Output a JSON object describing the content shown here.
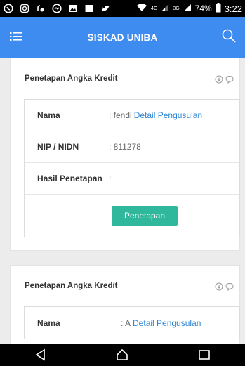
{
  "status_bar": {
    "network_labels": [
      "4G",
      "3G"
    ],
    "battery": "74%",
    "time": "3:22",
    "icons": [
      "whatsapp-icon",
      "instagram-icon",
      "wifi-calling-icon",
      "chat-bubble-icon",
      "gallery-icon",
      "box-icon",
      "twitter-icon",
      "wifi-icon",
      "signal-icon",
      "signal-icon",
      "battery-icon"
    ]
  },
  "header": {
    "title": "SISKAD UNIBA",
    "background_color": "#3f8cf0"
  },
  "cards": [
    {
      "title": "Penetapan Angka Kredit",
      "rows": [
        {
          "label": "Nama",
          "value": ": fendi",
          "link": "Detail Pengusulan"
        },
        {
          "label": "NIP / NIDN",
          "value": ": 811278"
        },
        {
          "label": "Hasil Penetapan",
          "value": ":"
        }
      ],
      "button_label": "Penetapan"
    },
    {
      "title": "Penetapan Angka Kredit",
      "rows": [
        {
          "label": "Nama",
          "value": ": A",
          "link": "Detail Pengusulan"
        }
      ]
    }
  ],
  "colors": {
    "accent": "#2f86d4",
    "button": "#2fb89b"
  }
}
